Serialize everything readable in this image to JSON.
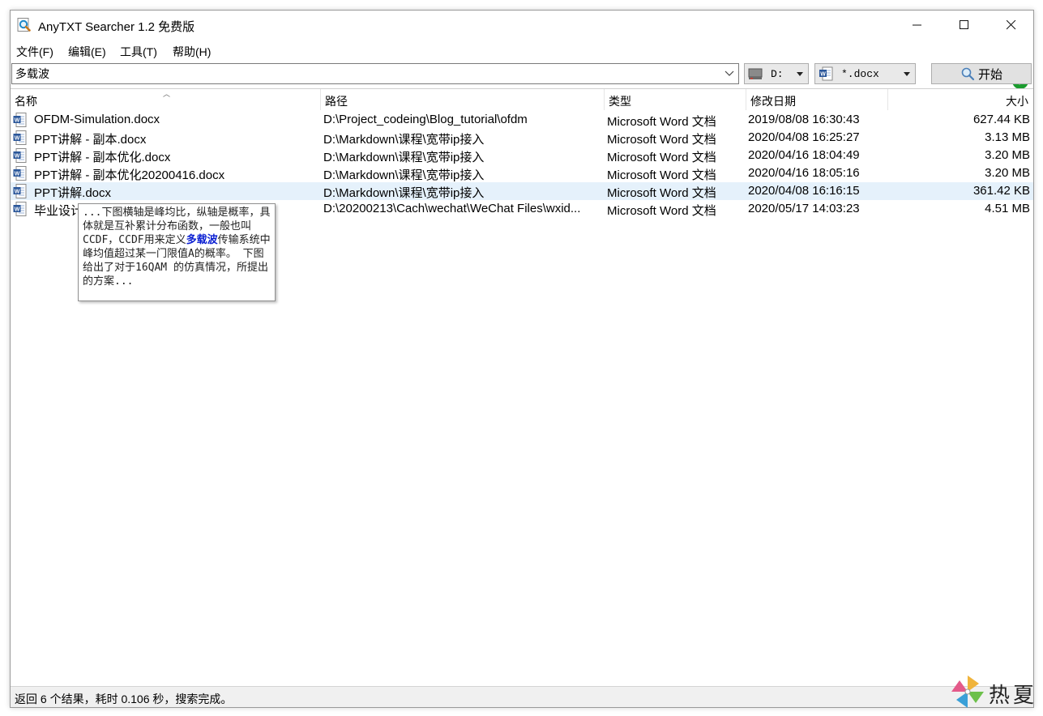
{
  "window": {
    "title": "AnyTXT Searcher 1.2 免费版"
  },
  "menu": [
    {
      "label": "文件(F)"
    },
    {
      "label": "编辑(E)"
    },
    {
      "label": "工具(T)"
    },
    {
      "label": "帮助(H)"
    }
  ],
  "toolbar": {
    "query": "多载波",
    "drive": "D:",
    "extension": "*.docx",
    "start_label": "开始"
  },
  "columns": {
    "name": "名称",
    "path": "路径",
    "type": "类型",
    "modified": "修改日期",
    "size": "大小"
  },
  "rows": [
    {
      "name": "OFDM-Simulation.docx",
      "path": "D:\\Project_codeing\\Blog_tutorial\\ofdm",
      "type": "Microsoft Word 文档",
      "modified": "2019/08/08  16:30:43",
      "size": "627.44 KB"
    },
    {
      "name": "PPT讲解 - 副本.docx",
      "path": "D:\\Markdown\\课程\\宽带ip接入",
      "type": "Microsoft Word 文档",
      "modified": "2020/04/08  16:25:27",
      "size": "3.13 MB"
    },
    {
      "name": "PPT讲解 - 副本优化.docx",
      "path": "D:\\Markdown\\课程\\宽带ip接入",
      "type": "Microsoft Word 文档",
      "modified": "2020/04/16  18:04:49",
      "size": "3.20 MB"
    },
    {
      "name": "PPT讲解 - 副本优化20200416.docx",
      "path": "D:\\Markdown\\课程\\宽带ip接入",
      "type": "Microsoft Word 文档",
      "modified": "2020/04/16  18:05:16",
      "size": "3.20 MB"
    },
    {
      "name": "PPT讲解.docx",
      "path": "D:\\Markdown\\课程\\宽带ip接入",
      "type": "Microsoft Word 文档",
      "modified": "2020/04/08  16:16:15",
      "size": "361.42 KB"
    },
    {
      "name": "毕业设计",
      "path": "D:\\20200213\\Cach\\wechat\\WeChat Files\\wxid...",
      "type": "Microsoft Word 文档",
      "modified": "2020/05/17  14:03:23",
      "size": "4.51 MB"
    }
  ],
  "tooltip": {
    "before": "...下图横轴是峰均比，纵轴是概率，具体就是互补累计分布函数，一般也叫CCDF，CCDF用来定义",
    "highlight": "多载波",
    "after": "传输系统中峰均值超过某一门限值A的概率。 下图给出了对于16QAM 的仿真情况，所提出的方案..."
  },
  "status": {
    "text": "返回 6 个结果，耗时 0.106 秒，搜索完成。"
  },
  "watermark": {
    "text": "热夏"
  },
  "colors": {
    "accent_green": "#1a9c2e",
    "selection": "#e5f1fb",
    "highlight": "#0a1fd2",
    "word_blue": "#2b579a"
  }
}
